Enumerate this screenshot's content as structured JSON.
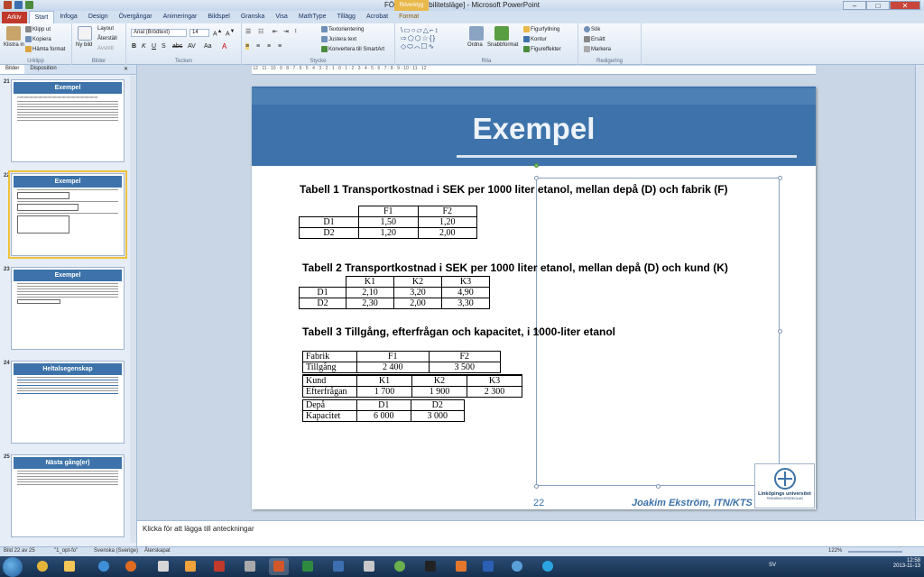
{
  "window": {
    "title": "FÖ9 [Kompatibilitetsläge] - Microsoft PowerPoint",
    "context_tab": "Ritverktyg"
  },
  "tabs": [
    "Arkiv",
    "Start",
    "Infoga",
    "Design",
    "Övergångar",
    "Animeringar",
    "Bildspel",
    "Granska",
    "Visa",
    "MathType",
    "Tillägg",
    "Acrobat",
    "Format"
  ],
  "ribbon": {
    "clipboard": {
      "paste": "Klistra in",
      "cut": "Klipp ut",
      "copy": "Kopiera",
      "format_painter": "Hämta format",
      "group": "Urklipp"
    },
    "slides": {
      "new": "Ny bild",
      "layout": "Layout",
      "reset": "Återställ",
      "section": "Avsnitt",
      "group": "Bilder"
    },
    "font": {
      "name": "Arial (Brödtext)",
      "size": "14",
      "group": "Tecken"
    },
    "paragraph": {
      "text_direction": "Textorientering",
      "align_text": "Justera text",
      "smartart": "Konvertera till SmartArt",
      "group": "Stycke"
    },
    "drawing": {
      "arrange": "Ordna",
      "quick_styles": "Snabbformat",
      "fill": "Figurfyllning",
      "outline": "Kontur",
      "effects": "Figureffekter",
      "group": "Rita"
    },
    "editing": {
      "find": "Sök",
      "replace": "Ersätt",
      "select": "Markera",
      "group": "Redigering"
    }
  },
  "panel": {
    "tabs": [
      "Bilder",
      "Disposition"
    ],
    "slides": [
      {
        "num": "21",
        "title": "Exempel",
        "selected": false
      },
      {
        "num": "22",
        "title": "Exempel",
        "selected": true
      },
      {
        "num": "23",
        "title": "Exempel",
        "selected": false
      },
      {
        "num": "24",
        "title": "Heltalsegenskap",
        "selected": false
      },
      {
        "num": "25",
        "title": "Nästa gång(er)",
        "selected": false
      }
    ]
  },
  "slide": {
    "title": "Exempel",
    "table1": {
      "caption": "Tabell 1 Transportkostnad i SEK per 1000 liter etanol, mellan depå (D) och fabrik (F)",
      "header": [
        "",
        "F1",
        "F2"
      ],
      "rows": [
        [
          "D1",
          "1,50",
          "1,20"
        ],
        [
          "D2",
          "1,20",
          "2,00"
        ]
      ]
    },
    "table2": {
      "caption": "Tabell 2 Transportkostnad i SEK per 1000 liter etanol, mellan depå (D) och kund (K)",
      "header": [
        "",
        "K1",
        "K2",
        "K3"
      ],
      "rows": [
        [
          "D1",
          "2,10",
          "3,20",
          "4,90"
        ],
        [
          "D2",
          "2,30",
          "2,00",
          "3,30"
        ]
      ]
    },
    "table3": {
      "caption": "Tabell 3 Tillgång, efterfrågan och kapacitet, i 1000-liter etanol",
      "fabrik": {
        "label": "Fabrik",
        "cols": [
          "F1",
          "F2"
        ],
        "row_label": "Tillgång",
        "values": [
          "2 400",
          "3 500"
        ]
      },
      "kund": {
        "label": "Kund",
        "cols": [
          "K1",
          "K2",
          "K3"
        ],
        "row_label": "Efterfrågan",
        "values": [
          "1 700",
          "1 900",
          "2 300"
        ]
      },
      "depa": {
        "label": "Depå",
        "cols": [
          "D1",
          "D2"
        ],
        "row_label": "Kapacitet",
        "values": [
          "6 000",
          "3 000"
        ]
      }
    },
    "page_number": "22",
    "author": "Joakim Ekström, ITN/KTS",
    "logo": {
      "name": "Linköpings universitet",
      "sub": "TEKNISKA HÖGSKOLAN"
    }
  },
  "notes_placeholder": "Klicka för att lägga till anteckningar",
  "status": {
    "slide": "Bild 22 av 25",
    "theme": "\"1_opt-fo\"",
    "language": "Svenska (Sverige)",
    "favorites": "Återskapat",
    "zoom": "122%"
  },
  "taskbar": {
    "lang": "SV",
    "time": "12:58",
    "date": "2013-11-13"
  }
}
